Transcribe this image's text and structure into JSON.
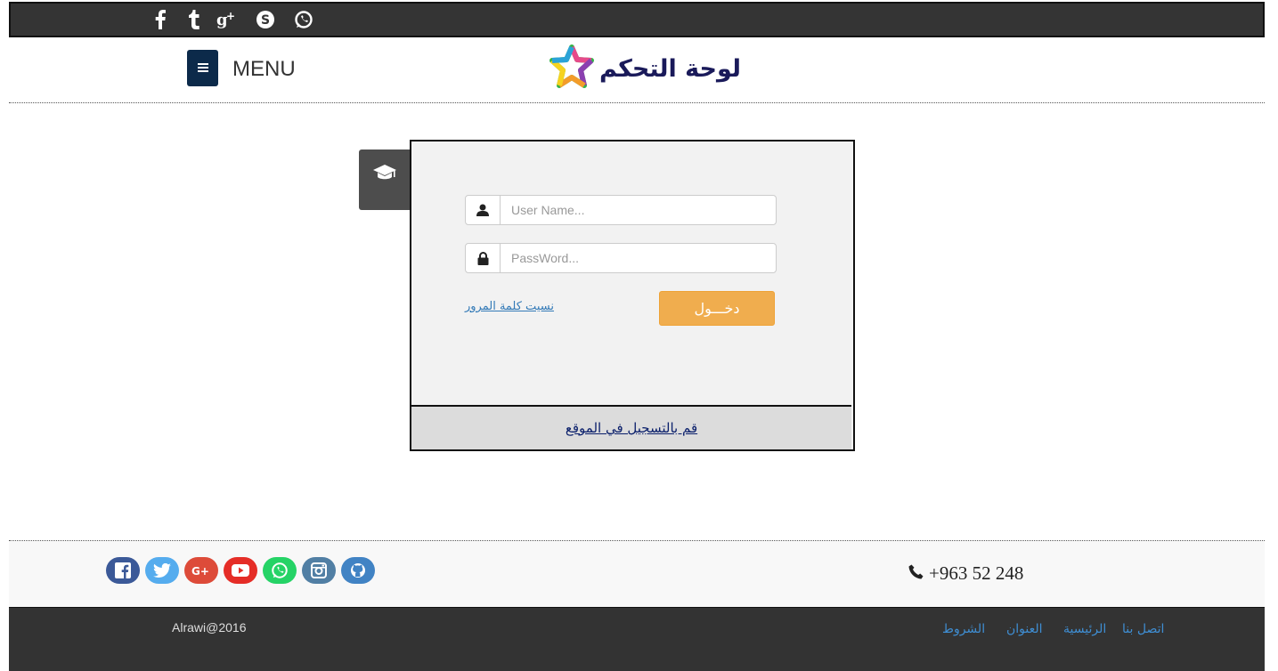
{
  "top_social": [
    "facebook-icon",
    "tumblr-icon",
    "google-plus-icon",
    "skype-icon",
    "whatsapp-icon"
  ],
  "header": {
    "menu_label": "MENU",
    "logo_text": "لوحة التحكم"
  },
  "login": {
    "username_placeholder": "User Name...",
    "password_placeholder": "PassWord...",
    "submit_label": "دخـــول",
    "forgot_label": "نسيت كلمة المرور",
    "register_label": "قم بالتسجيل في الموقع"
  },
  "footer": {
    "social": [
      {
        "icon": "facebook-icon",
        "color": "#3b5998"
      },
      {
        "icon": "twitter-icon",
        "color": "#55acee"
      },
      {
        "icon": "google-plus-icon",
        "color": "#dd4b39"
      },
      {
        "icon": "youtube-icon",
        "color": "#e52d27"
      },
      {
        "icon": "whatsapp-icon",
        "color": "#25d366"
      },
      {
        "icon": "instagram-icon",
        "color": "#517fa4"
      },
      {
        "icon": "github-icon",
        "color": "#4183c4"
      }
    ],
    "phone": "+963 52 248",
    "copyright": "Alrawi@2016",
    "links": [
      "اتصل بنا",
      "الرئيسية",
      "العنوان",
      "الشروط"
    ]
  },
  "colors": {
    "topbar": "#343434",
    "menu_button": "#0c2a4a",
    "login_button": "#f0ad4e",
    "link": "#337ab7",
    "footer_dark": "#333333"
  }
}
